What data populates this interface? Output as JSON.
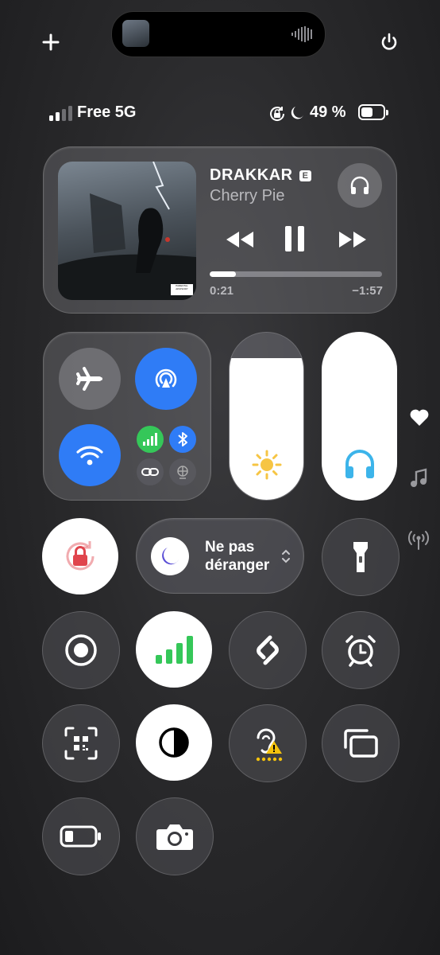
{
  "island": {
    "has_album_thumb": true
  },
  "status": {
    "carrier": "Free 5G",
    "battery": "49 %",
    "signal_bars_filled": 2,
    "battery_level": 0.49
  },
  "music": {
    "artist": "DRAKKAR",
    "explicit_badge": "E",
    "track": "Cherry Pie",
    "elapsed": "0:21",
    "remaining": "−1:57",
    "progress": 0.15,
    "advisory": "PARENTAL ADVISORY"
  },
  "connectivity": {
    "cellular_bars": 4
  },
  "sliders": {
    "brightness_level": 0.85,
    "volume_level": 1.0
  },
  "focus": {
    "label_line1": "Ne pas",
    "label_line2": "déranger"
  },
  "side": {
    "icons": [
      "heart-icon",
      "music-note-icon",
      "antenna-icon"
    ]
  },
  "colors": {
    "accent_blue": "#2f7cf6",
    "lock_red": "#e0454d",
    "moon_purple": "#5b4fd6",
    "green": "#35c759",
    "sun_yellow": "#f6c544",
    "headphones_blue": "#3cb4ea",
    "warn_yellow": "#f4c20d"
  }
}
